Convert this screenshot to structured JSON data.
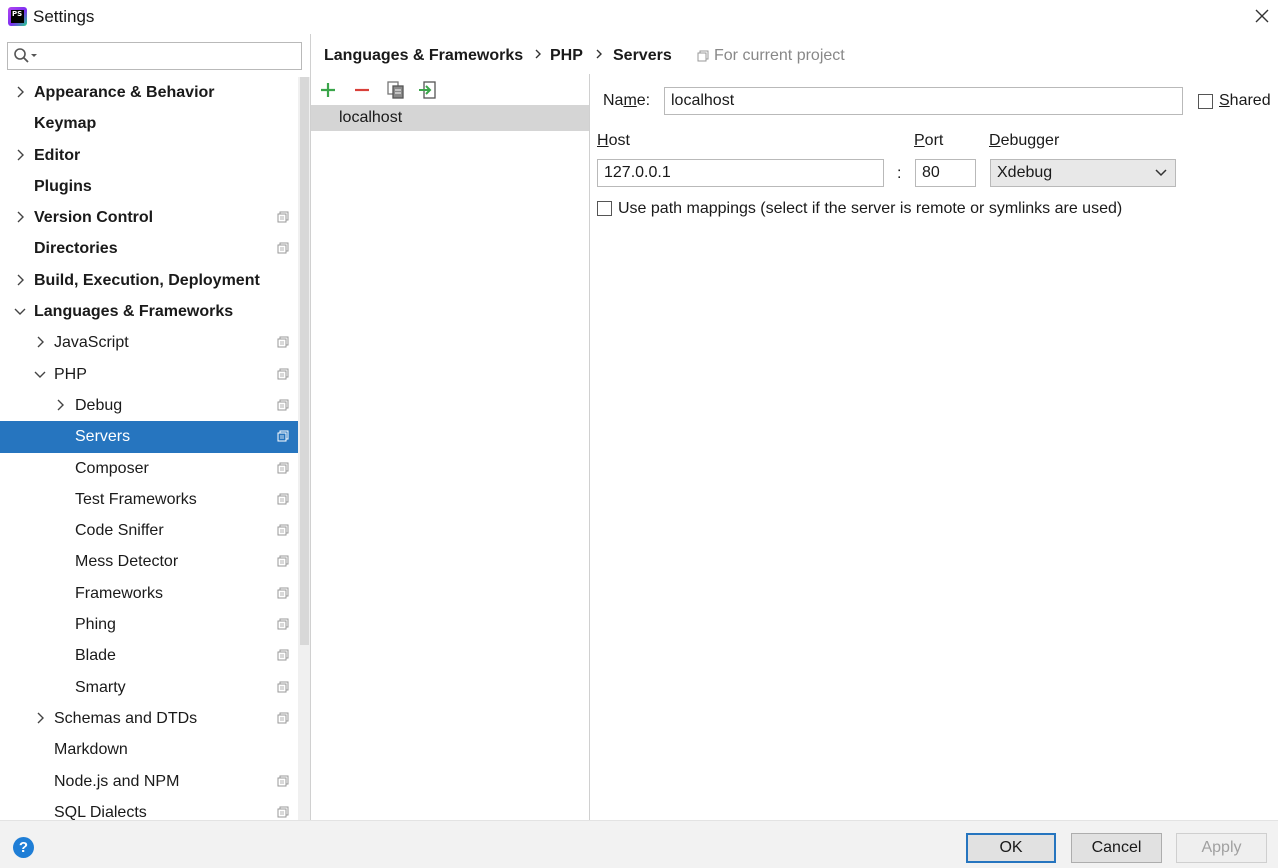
{
  "window": {
    "title": "Settings",
    "app_icon_text": "PS"
  },
  "search": {
    "placeholder": ""
  },
  "tree": [
    {
      "label": "Appearance & Behavior",
      "bold": true,
      "arrow": "right",
      "indent": 0,
      "proj": false
    },
    {
      "label": "Keymap",
      "bold": true,
      "arrow": "none",
      "indent": 0,
      "proj": false
    },
    {
      "label": "Editor",
      "bold": true,
      "arrow": "right",
      "indent": 0,
      "proj": false
    },
    {
      "label": "Plugins",
      "bold": true,
      "arrow": "none",
      "indent": 0,
      "proj": false
    },
    {
      "label": "Version Control",
      "bold": true,
      "arrow": "right",
      "indent": 0,
      "proj": true
    },
    {
      "label": "Directories",
      "bold": true,
      "arrow": "none",
      "indent": 0,
      "proj": true
    },
    {
      "label": "Build, Execution, Deployment",
      "bold": true,
      "arrow": "right",
      "indent": 0,
      "proj": false
    },
    {
      "label": "Languages & Frameworks",
      "bold": true,
      "arrow": "down",
      "indent": 0,
      "proj": false
    },
    {
      "label": "JavaScript",
      "bold": false,
      "arrow": "right",
      "indent": 1,
      "proj": true
    },
    {
      "label": "PHP",
      "bold": false,
      "arrow": "down",
      "indent": 1,
      "proj": true
    },
    {
      "label": "Debug",
      "bold": false,
      "arrow": "right",
      "indent": 2,
      "proj": true
    },
    {
      "label": "Servers",
      "bold": false,
      "arrow": "none",
      "indent": 2,
      "proj": true,
      "selected": true
    },
    {
      "label": "Composer",
      "bold": false,
      "arrow": "none",
      "indent": 2,
      "proj": true
    },
    {
      "label": "Test Frameworks",
      "bold": false,
      "arrow": "none",
      "indent": 2,
      "proj": true
    },
    {
      "label": "Code Sniffer",
      "bold": false,
      "arrow": "none",
      "indent": 2,
      "proj": true
    },
    {
      "label": "Mess Detector",
      "bold": false,
      "arrow": "none",
      "indent": 2,
      "proj": true
    },
    {
      "label": "Frameworks",
      "bold": false,
      "arrow": "none",
      "indent": 2,
      "proj": true
    },
    {
      "label": "Phing",
      "bold": false,
      "arrow": "none",
      "indent": 2,
      "proj": true
    },
    {
      "label": "Blade",
      "bold": false,
      "arrow": "none",
      "indent": 2,
      "proj": true
    },
    {
      "label": "Smarty",
      "bold": false,
      "arrow": "none",
      "indent": 2,
      "proj": true
    },
    {
      "label": "Schemas and DTDs",
      "bold": false,
      "arrow": "right",
      "indent": 1,
      "proj": true
    },
    {
      "label": "Markdown",
      "bold": false,
      "arrow": "none",
      "indent": 1,
      "proj": false
    },
    {
      "label": "Node.js and NPM",
      "bold": false,
      "arrow": "none",
      "indent": 1,
      "proj": true
    },
    {
      "label": "SQL Dialects",
      "bold": false,
      "arrow": "none",
      "indent": 1,
      "proj": true
    }
  ],
  "breadcrumb": {
    "items": [
      "Languages & Frameworks",
      "PHP",
      "Servers"
    ],
    "note": "For current project"
  },
  "servers": {
    "items": [
      "localhost"
    ]
  },
  "form": {
    "name_label": "Name:",
    "name_value": "localhost",
    "shared_label": "Shared",
    "host_label": "Host",
    "host_value": "127.0.0.1",
    "colon": ":",
    "port_label": "Port",
    "port_value": "80",
    "debugger_label": "Debugger",
    "debugger_value": "Xdebug",
    "path_mappings_label": "Use path mappings (select if the server is remote or symlinks are used)"
  },
  "footer": {
    "help": "?",
    "ok": "OK",
    "cancel": "Cancel",
    "apply": "Apply"
  },
  "colors": {
    "selection": "#2675bf",
    "add_icon": "#3aa54a",
    "remove_icon": "#d9403a"
  }
}
